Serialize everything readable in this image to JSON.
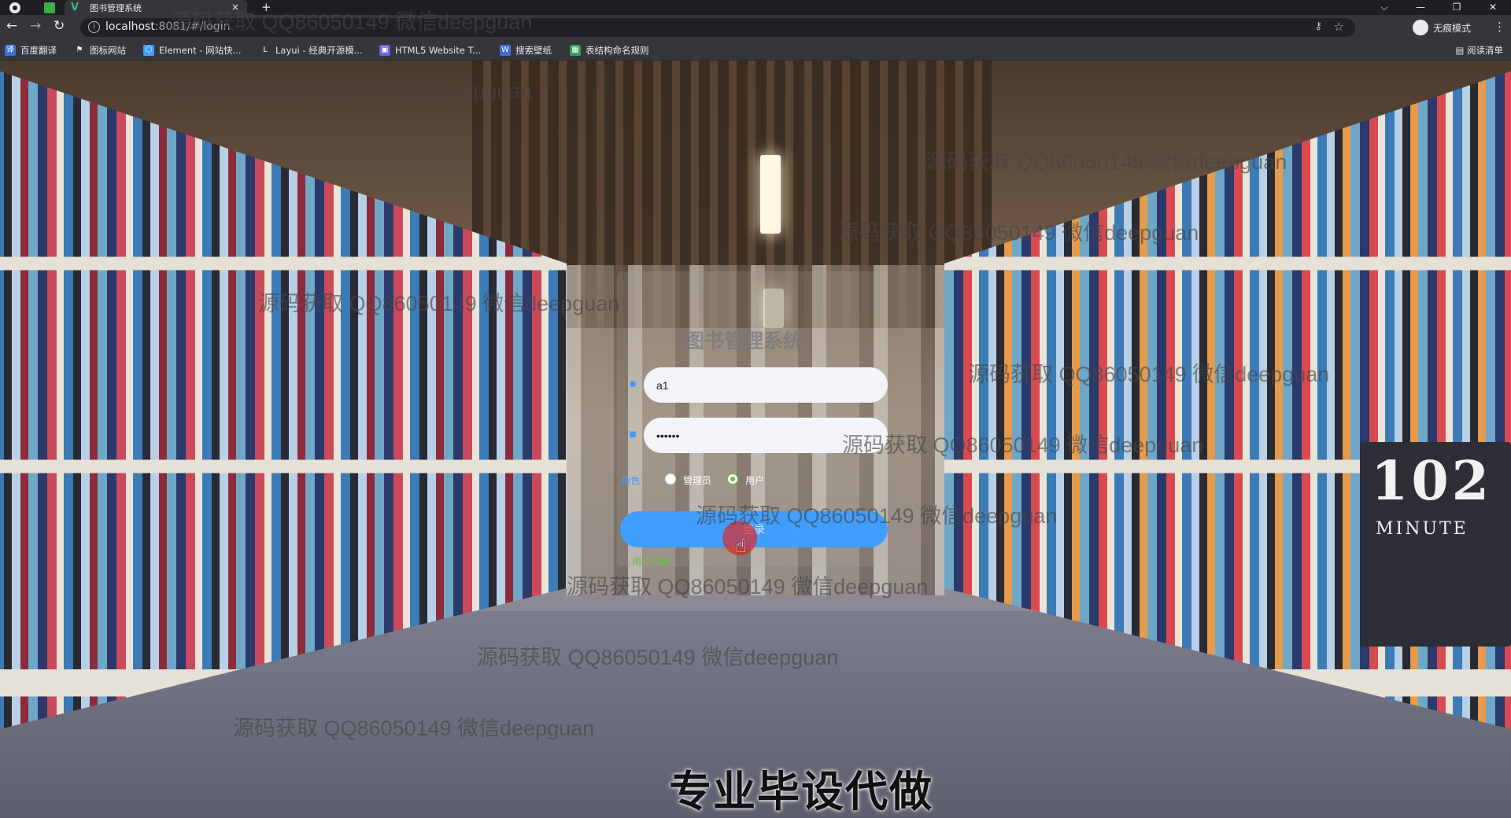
{
  "browser": {
    "tab_title": "图书管理系统",
    "tab_close": "×",
    "new_tab": "+",
    "window_controls": [
      "⌵",
      "—",
      "❐",
      "✕"
    ],
    "nav": {
      "back": "←",
      "forward": "→",
      "reload": "↻"
    },
    "url_host": "localhost",
    "url_rest": ":8081/#/login",
    "profile_label": "无痕模式",
    "menu": "⋮",
    "bookmarks": [
      {
        "label": "百度翻译",
        "color": "#3b6fd8",
        "glyph": "译"
      },
      {
        "label": "图标网站",
        "color": "#35363a",
        "glyph": "⚑"
      },
      {
        "label": "Element - 网站快...",
        "color": "#409eff",
        "glyph": "⬡"
      },
      {
        "label": "Layui - 经典开源模...",
        "color": "#35363a",
        "glyph": "L"
      },
      {
        "label": "HTML5 Website T...",
        "color": "#6c5ce7",
        "glyph": "▣"
      },
      {
        "label": "搜索壁纸",
        "color": "#3b6fd8",
        "glyph": "W"
      },
      {
        "label": "表结构命名规则",
        "color": "#2e9d5b",
        "glyph": "▦"
      }
    ],
    "reading_list": "阅读清单"
  },
  "login": {
    "title": "图书管理系统",
    "username_value": "a1",
    "password_value": "••••••",
    "role_label": "角色",
    "roles": [
      {
        "label": "管理员",
        "checked": false
      },
      {
        "label": "用户",
        "checked": true
      }
    ],
    "login_button": "登录",
    "register_link": "用户注册"
  },
  "background": {
    "book_cover_big": "102",
    "book_cover_sub": "MINUTE"
  },
  "watermark_text": "源码获取 QQ86050149 微信deepguan",
  "caption": "专业毕设代做",
  "colors": {
    "primary": "#409eff",
    "success": "#67c23a"
  }
}
